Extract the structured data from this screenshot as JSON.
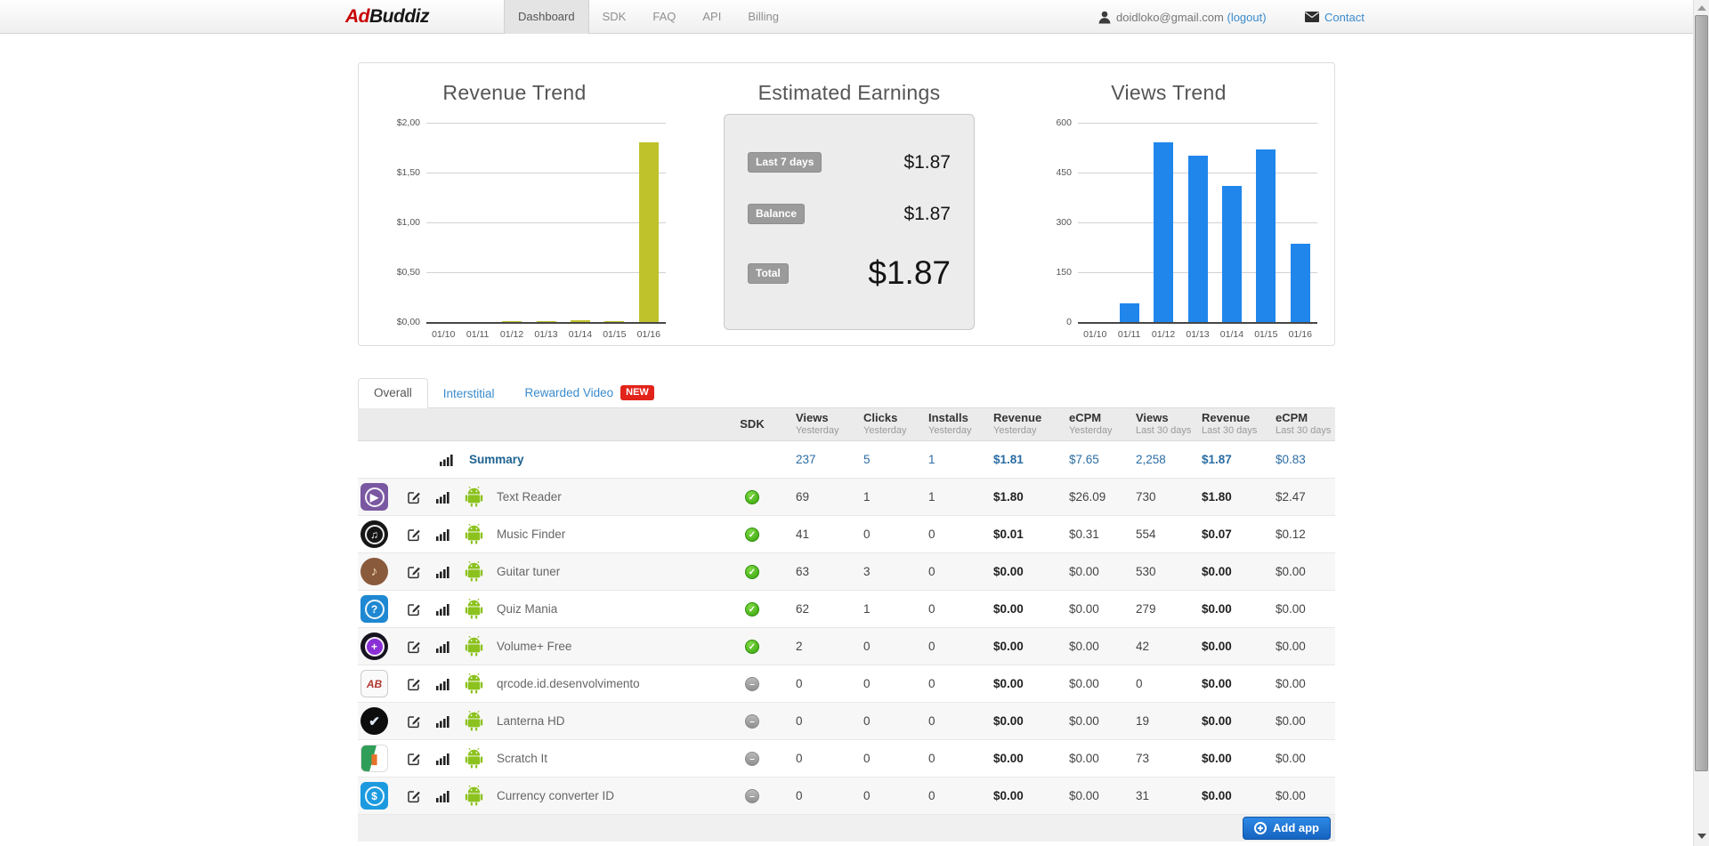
{
  "header": {
    "logo_part1": "Ad",
    "logo_part2": "Buddiz",
    "nav": [
      {
        "label": "Dashboard",
        "active": true
      },
      {
        "label": "SDK",
        "active": false
      },
      {
        "label": "FAQ",
        "active": false
      },
      {
        "label": "API",
        "active": false
      },
      {
        "label": "Billing",
        "active": false
      }
    ],
    "user_email": "doidloko@gmail.com",
    "logout_label": "(logout)",
    "contact_label": "Contact"
  },
  "chart_data": [
    {
      "type": "bar",
      "title": "Revenue Trend",
      "categories": [
        "01/10",
        "01/11",
        "01/12",
        "01/13",
        "01/14",
        "01/15",
        "01/16"
      ],
      "values": [
        0,
        0,
        0.01,
        0.01,
        0.02,
        0.01,
        1.8
      ],
      "ylim": [
        0,
        2.0
      ],
      "ytick_labels": [
        "$2,00",
        "$1,50",
        "$1,00",
        "$0,50",
        "$0,00"
      ],
      "xlabel": "",
      "ylabel": "",
      "grid": true,
      "legend_position": "none",
      "bar_color": "#c0c22c"
    },
    {
      "type": "bar",
      "title": "Views Trend",
      "categories": [
        "01/10",
        "01/11",
        "01/12",
        "01/13",
        "01/14",
        "01/15",
        "01/16"
      ],
      "values": [
        0,
        55,
        540,
        500,
        410,
        520,
        237
      ],
      "ylim": [
        0,
        600
      ],
      "ytick_labels": [
        "600",
        "450",
        "300",
        "150",
        "0"
      ],
      "xlabel": "",
      "ylabel": "",
      "grid": true,
      "legend_position": "none",
      "bar_color": "#2086ec"
    }
  ],
  "earnings": {
    "title": "Estimated Earnings",
    "rows": [
      {
        "label": "Last 7 days",
        "value": "$1.87",
        "large": false
      },
      {
        "label": "Balance",
        "value": "$1.87",
        "large": false
      },
      {
        "label": "Total",
        "value": "$1.87",
        "large": true
      }
    ]
  },
  "tabs": [
    {
      "label": "Overall",
      "active": true,
      "badge": ""
    },
    {
      "label": "Interstitial",
      "active": false,
      "badge": ""
    },
    {
      "label": "Rewarded Video",
      "active": false,
      "badge": "NEW"
    }
  ],
  "table": {
    "columns": [
      {
        "label": "SDK",
        "sub": ""
      },
      {
        "label": "Views",
        "sub": "Yesterday"
      },
      {
        "label": "Clicks",
        "sub": "Yesterday"
      },
      {
        "label": "Installs",
        "sub": "Yesterday"
      },
      {
        "label": "Revenue",
        "sub": "Yesterday"
      },
      {
        "label": "eCPM",
        "sub": "Yesterday"
      },
      {
        "label": "Views",
        "sub": "Last 30 days"
      },
      {
        "label": "Revenue",
        "sub": "Last 30 days"
      },
      {
        "label": "eCPM",
        "sub": "Last 30 days"
      }
    ],
    "bold_value_indexes": [
      3,
      6
    ],
    "summary": {
      "label": "Summary",
      "values": [
        "237",
        "5",
        "1",
        "$1.81",
        "$7.65",
        "2,258",
        "$1.87",
        "$0.83"
      ]
    },
    "rows": [
      {
        "name": "Text Reader",
        "sdk": "integrated",
        "values": [
          "69",
          "1",
          "1",
          "$1.80",
          "$26.09",
          "730",
          "$1.80",
          "$2.47"
        ],
        "icon": {
          "shape": "square",
          "bg": "#7a58a1",
          "glyph": "▶",
          "fg": "#ffffff",
          "ring": true
        }
      },
      {
        "name": "Music Finder",
        "sdk": "integrated",
        "values": [
          "41",
          "0",
          "0",
          "$0.01",
          "$0.31",
          "554",
          "$0.07",
          "$0.12"
        ],
        "icon": {
          "shape": "circle",
          "bg": "#161616",
          "glyph": "♫",
          "fg": "#ffffff",
          "ring": true
        }
      },
      {
        "name": "Guitar tuner",
        "sdk": "integrated",
        "values": [
          "63",
          "3",
          "0",
          "$0.00",
          "$0.00",
          "530",
          "$0.00",
          "$0.00"
        ],
        "icon": {
          "shape": "circle",
          "bg": "#8a5a3c",
          "glyph": "♪",
          "fg": "#f3e0c0"
        }
      },
      {
        "name": "Quiz Mania",
        "sdk": "integrated",
        "values": [
          "62",
          "1",
          "0",
          "$0.00",
          "$0.00",
          "279",
          "$0.00",
          "$0.00"
        ],
        "icon": {
          "shape": "square",
          "bg": "#1e88d2",
          "glyph": "?",
          "fg": "#ffffff",
          "ring": true
        }
      },
      {
        "name": "Volume+ Free",
        "sdk": "integrated",
        "values": [
          "2",
          "0",
          "0",
          "$0.00",
          "$0.00",
          "42",
          "$0.00",
          "$0.00"
        ],
        "icon": {
          "shape": "circle",
          "bg": "#17131f",
          "glyph": "+",
          "fg": "#ffffff",
          "ring": true,
          "inner_bg": "#8b2fd6"
        }
      },
      {
        "name": "qrcode.id.desenvolvimento",
        "sdk": "not-integrated",
        "values": [
          "0",
          "0",
          "0",
          "$0.00",
          "$0.00",
          "0",
          "$0.00",
          "$0.00"
        ],
        "icon": {
          "shape": "square",
          "bg": "#fafafa",
          "glyph": "AB",
          "fg": "#b03530",
          "border": true
        }
      },
      {
        "name": "Lanterna HD",
        "sdk": "not-integrated",
        "values": [
          "0",
          "0",
          "0",
          "$0.00",
          "$0.00",
          "19",
          "$0.00",
          "$0.00"
        ],
        "icon": {
          "shape": "circle",
          "bg": "#0d0d0d",
          "glyph": "✔",
          "fg": "#dfe9f5"
        }
      },
      {
        "name": "Scratch It",
        "sdk": "not-integrated",
        "values": [
          "0",
          "0",
          "0",
          "$0.00",
          "$0.00",
          "73",
          "$0.00",
          "$0.00"
        ],
        "icon": {
          "shape": "square",
          "split": true,
          "glyph": "▮",
          "fg": "#e8732a"
        }
      },
      {
        "name": "Currency converter ID",
        "sdk": "not-integrated",
        "values": [
          "0",
          "0",
          "0",
          "$0.00",
          "$0.00",
          "31",
          "$0.00",
          "$0.00"
        ],
        "icon": {
          "shape": "square",
          "bg": "#1c9ae0",
          "glyph": "$",
          "fg": "#ffffff",
          "ring": true
        }
      }
    ],
    "add_app_label": "Add app"
  },
  "colors": {
    "link_blue": "#3a8bcd",
    "revenue_bar": "#c0c22c",
    "views_bar": "#2086ec",
    "new_badge_red": "#e2231a",
    "add_app_button_blue": "#1d74d4",
    "android_green": "#8cc21e",
    "sdk_integrated_green": "#46b511",
    "sdk_not_integrated_gray": "#a5a5a5",
    "logo_red": "#c80000"
  },
  "icons": {
    "user-icon": "person silhouette",
    "mail-icon": "envelope",
    "stats-icon": "ascending bar chart",
    "edit-icon": "pencil in square",
    "android-icon": "android robot",
    "sdk-integrated-icon": "green check circle",
    "sdk-not-integrated-icon": "gray minus circle",
    "add-icon": "plus in circle",
    "scroll-up-icon": "triangle up",
    "scroll-down-icon": "triangle down"
  }
}
